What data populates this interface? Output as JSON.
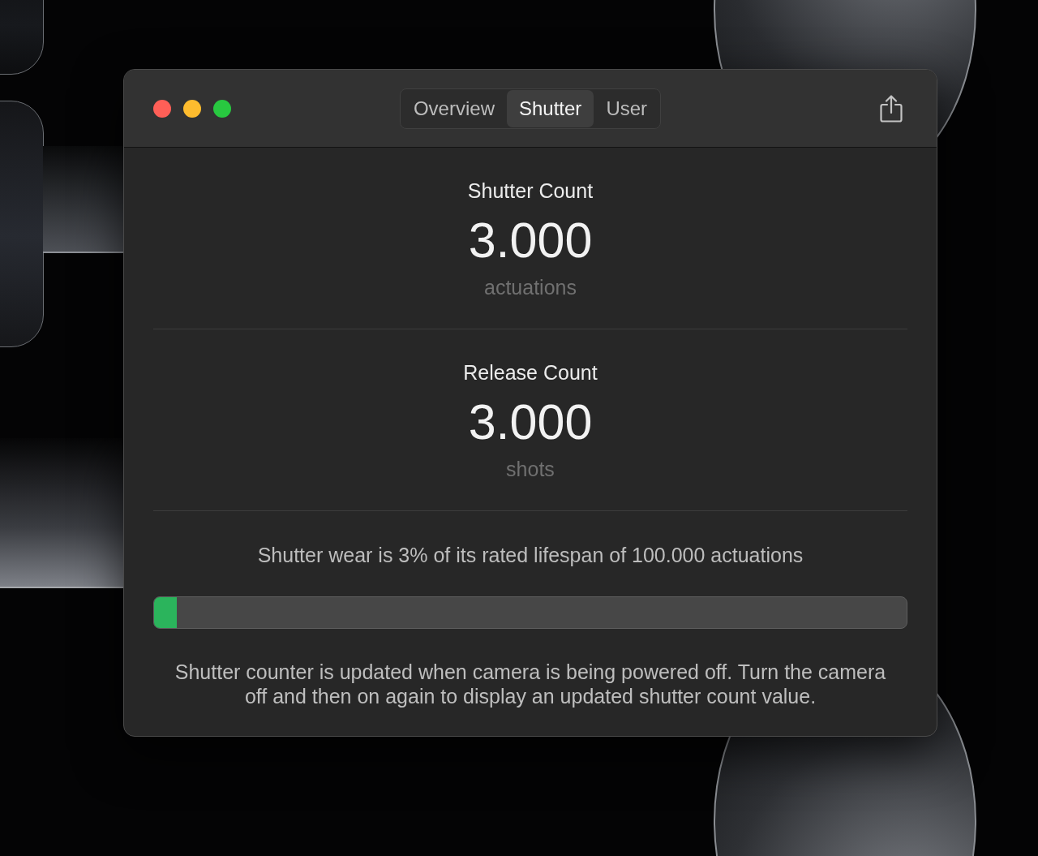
{
  "window": {
    "tabs": [
      {
        "label": "Overview",
        "selected": false
      },
      {
        "label": "Shutter",
        "selected": true
      },
      {
        "label": "User",
        "selected": false
      }
    ]
  },
  "counters": [
    {
      "title": "Shutter Count",
      "value": "3.000",
      "unit": "actuations"
    },
    {
      "title": "Release Count",
      "value": "3.000",
      "unit": "shots"
    }
  ],
  "wear": {
    "text": "Shutter wear is 3% of its rated lifespan of 100.000 actuations",
    "level": 0.03
  },
  "note": "Shutter counter is updated when camera is being powered off. Turn the camera off and then on again to display an updated shutter count value."
}
